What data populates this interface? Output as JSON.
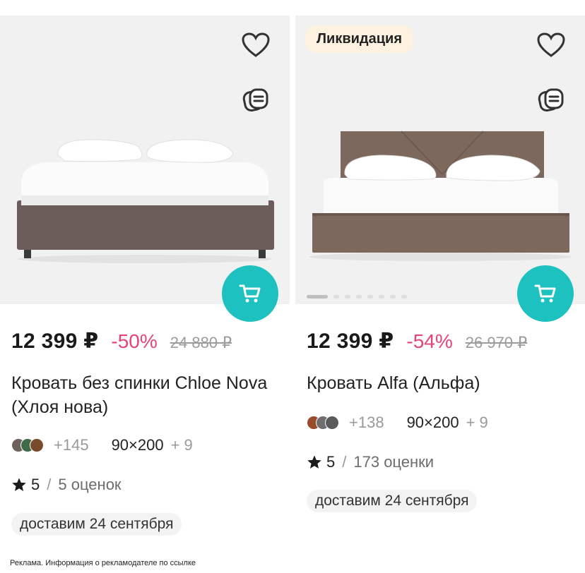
{
  "products": [
    {
      "price": "12 399 ₽",
      "discount": "-50%",
      "old_price": "24 880 ₽",
      "title": "Кровать без спинки Chloe Nova (Хлоя нова)",
      "colors_extra": "+145",
      "size": "90×200",
      "sizes_extra": "+ 9",
      "rating": "5",
      "rating_separator": "/",
      "reviews": "5 оценок",
      "delivery": "доставим 24 сентября",
      "swatch_colors": [
        "#6e625c",
        "#3f6b4a",
        "#7a4a2c"
      ]
    },
    {
      "badge": "Ликвидация",
      "price": "12 399 ₽",
      "discount": "-54%",
      "old_price": "26 970 ₽",
      "title": "Кровать Alfa (Альфа)",
      "colors_extra": "+138",
      "size": "90×200",
      "sizes_extra": "+ 9",
      "rating": "5",
      "rating_separator": "/",
      "reviews": "173 оценки",
      "delivery": "доставим 24 сентября",
      "swatch_colors": [
        "#9a4b2c",
        "#6f6f6f",
        "#5a5a5a"
      ]
    }
  ],
  "ad_disclaimer": "Реклама. Информация о рекламодателе по ссылке",
  "colors": {
    "accent": "#1cc1c0",
    "discount": "#e5437a"
  }
}
